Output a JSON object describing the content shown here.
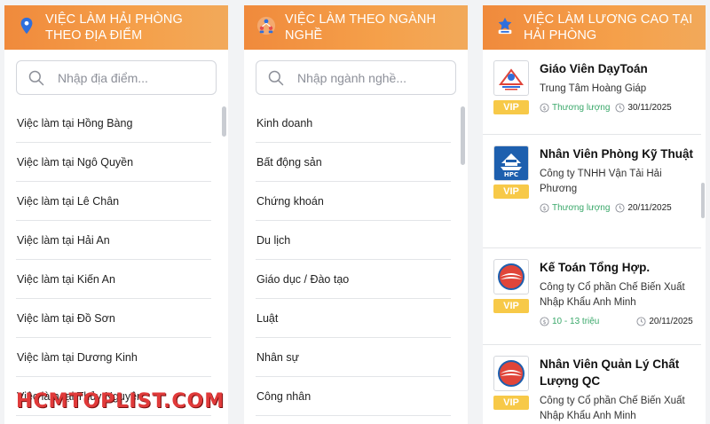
{
  "colors": {
    "header_gradient": "#f08a3c",
    "vip": "#f7c948",
    "salary": "#3aa86a",
    "watermark": "#e03a3a"
  },
  "location_panel": {
    "title": "VIỆC LÀM HẢI PHÒNG THEO ĐỊA ĐIỂM",
    "icon": "location-pin-icon",
    "search_placeholder": "Nhập địa điểm...",
    "items": [
      "Việc làm tại Hồng Bàng",
      "Việc làm tại Ngô Quyền",
      "Việc làm tại Lê Chân",
      "Việc làm tại Hải An",
      "Việc làm tại Kiến An",
      "Việc làm tại Đồ Sơn",
      "Việc làm tại Dương Kinh",
      "Việc làm tại Thủy Nguyên"
    ]
  },
  "industry_panel": {
    "title": "VIỆC LÀM THEO NGÀNH NGHỀ",
    "icon": "people-network-icon",
    "search_placeholder": "Nhập ngành nghề...",
    "items": [
      "Kinh doanh",
      "Bất động sản",
      "Chứng khoán",
      "Du lịch",
      "Giáo dục / Đào tạo",
      "Luật",
      "Nhân sự",
      "Công nhân"
    ]
  },
  "jobs_panel": {
    "title": "VIỆC LÀM LƯƠNG CAO TẠI HẢI PHÒNG",
    "icon": "user-award-icon",
    "jobs": [
      {
        "title": "Giáo Viên DạyToán",
        "company": "Trung Tâm Hoàng Giáp",
        "salary": "Thương lượng",
        "date": "30/11/2025",
        "vip": "VIP"
      },
      {
        "title": "Nhân Viên Phòng Kỹ Thuật",
        "company": "Công ty TNHH Vận Tải Hải Phương",
        "salary": "Thương lượng",
        "date": "20/11/2025",
        "vip": "VIP",
        "logo_text": "HPC"
      },
      {
        "title": "Kế Toán Tổng Hợp.",
        "company": "Công ty Cổ phần Chế Biến Xuất Nhập Khẩu Anh Minh",
        "salary": "10 - 13 triệu",
        "date": "20/11/2025",
        "vip": "VIP"
      },
      {
        "title": "Nhân Viên Quản Lý Chất Lượng QC",
        "company": "Công ty Cổ phần Chế Biến Xuất Nhập Khẩu Anh Minh",
        "salary": "",
        "date": "",
        "vip": "VIP"
      }
    ]
  },
  "watermark": "HCMTOPLIST.COM"
}
